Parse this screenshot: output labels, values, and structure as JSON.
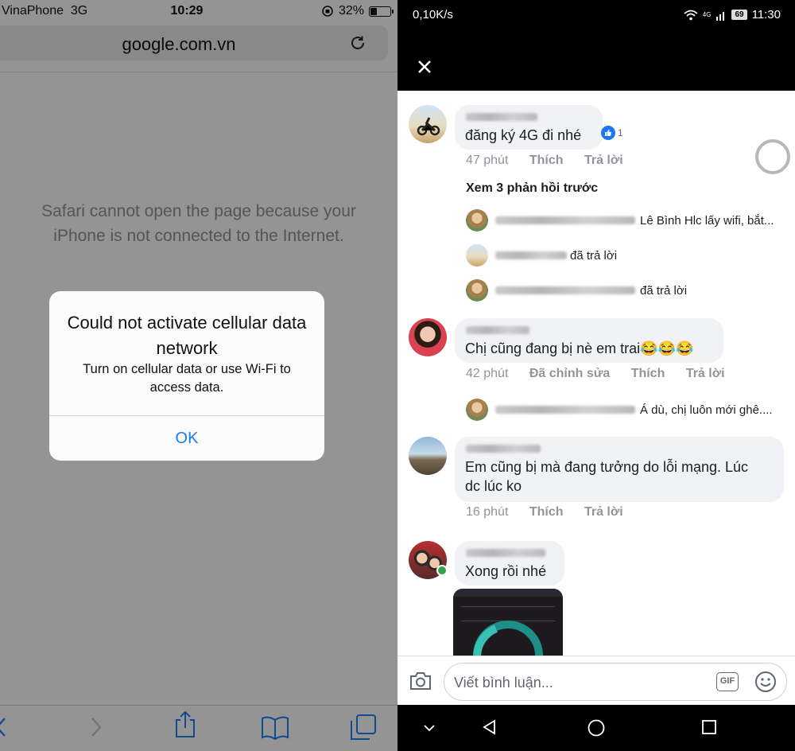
{
  "left": {
    "status": {
      "carrier": "VinaPhone",
      "network": "3G",
      "time": "10:29",
      "battery": "32%",
      "battery_level": 0.32
    },
    "url": "google.com.vn",
    "error_message": "Safari cannot open the page because your iPhone is not connected to the Internet.",
    "alert": {
      "title": "Could not activate cellular data network",
      "body": "Turn on cellular data or use Wi-Fi to access data.",
      "ok": "OK"
    },
    "colors": {
      "accent": "#1b7cf0"
    }
  },
  "right": {
    "status": {
      "speed": "0,10K/s",
      "network": "4G",
      "battery": "69",
      "time": "11:30"
    },
    "comments": [
      {
        "text": "đăng ký 4G đi nhé",
        "like_count": "1",
        "time": "47 phút",
        "like": "Thích",
        "reply": "Trả lời"
      },
      {
        "text": "Chị cũng đang bị nè em trai😂😂😂",
        "time": "42 phút",
        "edited": "Đã chỉnh sửa",
        "like": "Thích",
        "reply": "Trả lời"
      },
      {
        "text_line1": "Em cũng bị mà đang tưởng do lỗi mạng. Lúc",
        "text_line2": "dc lúc ko",
        "time": "16 phút",
        "like": "Thích",
        "reply": "Trả lời"
      },
      {
        "text": "Xong rồi nhé"
      }
    ],
    "view_previous": "Xem 3 phản hồi trước",
    "replies": [
      {
        "text": "Lê Bình Hlc lấy wifi, bắt..."
      },
      {
        "text": "đã trả lời"
      },
      {
        "text": "đã trả lời"
      },
      {
        "text": "Á dù, chị luôn mới ghê...."
      }
    ],
    "composer": {
      "placeholder": "Viết bình luận...",
      "gif": "GIF"
    },
    "colors": {
      "like_blue": "#1877f2",
      "online_green": "#31a24c"
    }
  }
}
